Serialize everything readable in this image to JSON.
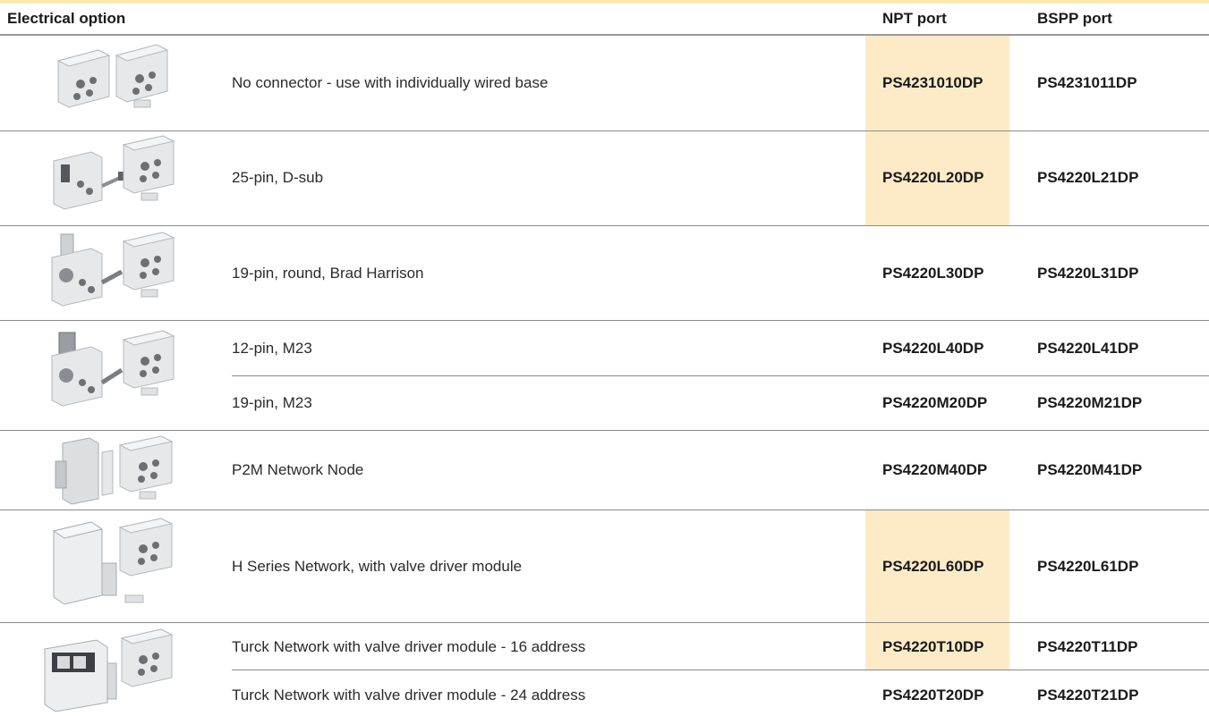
{
  "header": {
    "electrical_option": "Electrical option",
    "npt_port": "NPT port",
    "bspp_port": "BSPP port"
  },
  "colors": {
    "highlight": "#fdebc8",
    "top_accent": "#fde9b0",
    "rule": "#8a8a8a"
  },
  "rows": [
    {
      "desc": "No connector - use with individually wired base",
      "npt": "PS4231010DP",
      "bspp": "PS4231011DP",
      "npt_highlight": true
    },
    {
      "desc": "25-pin, D-sub",
      "npt": "PS4220L20DP",
      "bspp": "PS4220L21DP",
      "npt_highlight": true
    },
    {
      "desc": "19-pin, round, Brad Harrison",
      "npt": "PS4220L30DP",
      "bspp": "PS4220L31DP",
      "npt_highlight": true
    },
    {
      "desc": "12-pin, M23",
      "npt": "PS4220L40DP",
      "bspp": "PS4220L41DP",
      "npt_highlight": false
    },
    {
      "desc": "19-pin, M23",
      "npt": "PS4220M20DP",
      "bspp": "PS4220M21DP",
      "npt_highlight": false
    },
    {
      "desc": "P2M Network Node",
      "npt": "PS4220M40DP",
      "bspp": "PS4220M41DP",
      "npt_highlight": false
    },
    {
      "desc": "H Series Network, with valve driver module",
      "npt": "PS4220L60DP",
      "bspp": "PS4220L61DP",
      "npt_highlight": true
    },
    {
      "desc": "Turck Network with valve driver module - 16 address",
      "npt": "PS4220T10DP",
      "bspp": "PS4220T11DP",
      "npt_highlight": true
    },
    {
      "desc": "Turck Network with valve driver module - 24 address",
      "npt": "PS4220T20DP",
      "bspp": "PS4220T21DP",
      "npt_highlight": false
    }
  ],
  "images": [
    {
      "icon": "manifold-end-plates-icon"
    },
    {
      "icon": "dsub-connector-end-plates-icon"
    },
    {
      "icon": "round-connector-end-plates-icon"
    },
    {
      "icon": "m23-connector-end-plates-icon"
    },
    {
      "icon": "network-node-end-plates-icon"
    },
    {
      "icon": "h-series-module-end-plates-icon"
    },
    {
      "icon": "turck-module-end-plates-icon"
    }
  ]
}
